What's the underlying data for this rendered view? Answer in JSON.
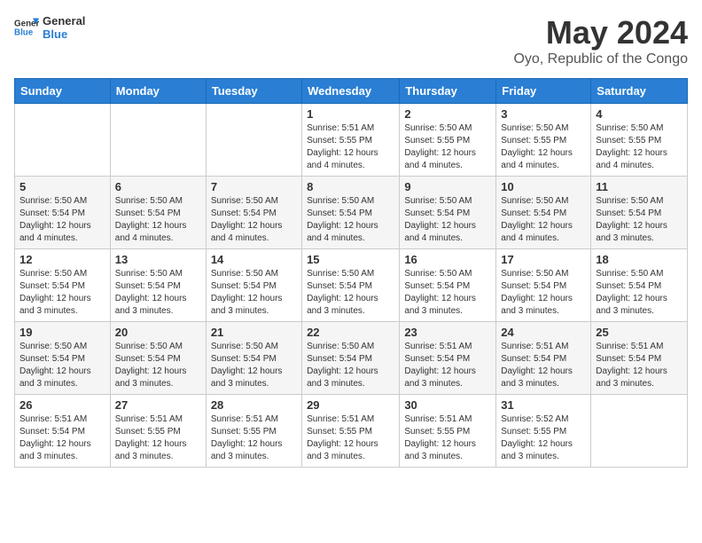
{
  "header": {
    "logo_line1": "General",
    "logo_line2": "Blue",
    "month_year": "May 2024",
    "location": "Oyo, Republic of the Congo"
  },
  "weekdays": [
    "Sunday",
    "Monday",
    "Tuesday",
    "Wednesday",
    "Thursday",
    "Friday",
    "Saturday"
  ],
  "weeks": [
    [
      {
        "day": "",
        "info": ""
      },
      {
        "day": "",
        "info": ""
      },
      {
        "day": "",
        "info": ""
      },
      {
        "day": "1",
        "info": "Sunrise: 5:51 AM\nSunset: 5:55 PM\nDaylight: 12 hours\nand 4 minutes."
      },
      {
        "day": "2",
        "info": "Sunrise: 5:50 AM\nSunset: 5:55 PM\nDaylight: 12 hours\nand 4 minutes."
      },
      {
        "day": "3",
        "info": "Sunrise: 5:50 AM\nSunset: 5:55 PM\nDaylight: 12 hours\nand 4 minutes."
      },
      {
        "day": "4",
        "info": "Sunrise: 5:50 AM\nSunset: 5:55 PM\nDaylight: 12 hours\nand 4 minutes."
      }
    ],
    [
      {
        "day": "5",
        "info": "Sunrise: 5:50 AM\nSunset: 5:54 PM\nDaylight: 12 hours\nand 4 minutes."
      },
      {
        "day": "6",
        "info": "Sunrise: 5:50 AM\nSunset: 5:54 PM\nDaylight: 12 hours\nand 4 minutes."
      },
      {
        "day": "7",
        "info": "Sunrise: 5:50 AM\nSunset: 5:54 PM\nDaylight: 12 hours\nand 4 minutes."
      },
      {
        "day": "8",
        "info": "Sunrise: 5:50 AM\nSunset: 5:54 PM\nDaylight: 12 hours\nand 4 minutes."
      },
      {
        "day": "9",
        "info": "Sunrise: 5:50 AM\nSunset: 5:54 PM\nDaylight: 12 hours\nand 4 minutes."
      },
      {
        "day": "10",
        "info": "Sunrise: 5:50 AM\nSunset: 5:54 PM\nDaylight: 12 hours\nand 4 minutes."
      },
      {
        "day": "11",
        "info": "Sunrise: 5:50 AM\nSunset: 5:54 PM\nDaylight: 12 hours\nand 3 minutes."
      }
    ],
    [
      {
        "day": "12",
        "info": "Sunrise: 5:50 AM\nSunset: 5:54 PM\nDaylight: 12 hours\nand 3 minutes."
      },
      {
        "day": "13",
        "info": "Sunrise: 5:50 AM\nSunset: 5:54 PM\nDaylight: 12 hours\nand 3 minutes."
      },
      {
        "day": "14",
        "info": "Sunrise: 5:50 AM\nSunset: 5:54 PM\nDaylight: 12 hours\nand 3 minutes."
      },
      {
        "day": "15",
        "info": "Sunrise: 5:50 AM\nSunset: 5:54 PM\nDaylight: 12 hours\nand 3 minutes."
      },
      {
        "day": "16",
        "info": "Sunrise: 5:50 AM\nSunset: 5:54 PM\nDaylight: 12 hours\nand 3 minutes."
      },
      {
        "day": "17",
        "info": "Sunrise: 5:50 AM\nSunset: 5:54 PM\nDaylight: 12 hours\nand 3 minutes."
      },
      {
        "day": "18",
        "info": "Sunrise: 5:50 AM\nSunset: 5:54 PM\nDaylight: 12 hours\nand 3 minutes."
      }
    ],
    [
      {
        "day": "19",
        "info": "Sunrise: 5:50 AM\nSunset: 5:54 PM\nDaylight: 12 hours\nand 3 minutes."
      },
      {
        "day": "20",
        "info": "Sunrise: 5:50 AM\nSunset: 5:54 PM\nDaylight: 12 hours\nand 3 minutes."
      },
      {
        "day": "21",
        "info": "Sunrise: 5:50 AM\nSunset: 5:54 PM\nDaylight: 12 hours\nand 3 minutes."
      },
      {
        "day": "22",
        "info": "Sunrise: 5:50 AM\nSunset: 5:54 PM\nDaylight: 12 hours\nand 3 minutes."
      },
      {
        "day": "23",
        "info": "Sunrise: 5:51 AM\nSunset: 5:54 PM\nDaylight: 12 hours\nand 3 minutes."
      },
      {
        "day": "24",
        "info": "Sunrise: 5:51 AM\nSunset: 5:54 PM\nDaylight: 12 hours\nand 3 minutes."
      },
      {
        "day": "25",
        "info": "Sunrise: 5:51 AM\nSunset: 5:54 PM\nDaylight: 12 hours\nand 3 minutes."
      }
    ],
    [
      {
        "day": "26",
        "info": "Sunrise: 5:51 AM\nSunset: 5:54 PM\nDaylight: 12 hours\nand 3 minutes."
      },
      {
        "day": "27",
        "info": "Sunrise: 5:51 AM\nSunset: 5:55 PM\nDaylight: 12 hours\nand 3 minutes."
      },
      {
        "day": "28",
        "info": "Sunrise: 5:51 AM\nSunset: 5:55 PM\nDaylight: 12 hours\nand 3 minutes."
      },
      {
        "day": "29",
        "info": "Sunrise: 5:51 AM\nSunset: 5:55 PM\nDaylight: 12 hours\nand 3 minutes."
      },
      {
        "day": "30",
        "info": "Sunrise: 5:51 AM\nSunset: 5:55 PM\nDaylight: 12 hours\nand 3 minutes."
      },
      {
        "day": "31",
        "info": "Sunrise: 5:52 AM\nSunset: 5:55 PM\nDaylight: 12 hours\nand 3 minutes."
      },
      {
        "day": "",
        "info": ""
      }
    ]
  ]
}
